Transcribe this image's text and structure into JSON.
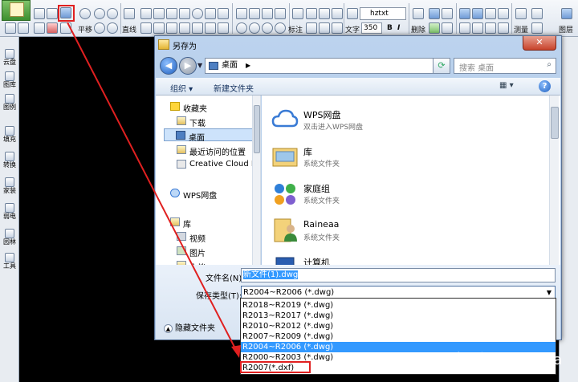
{
  "toolbar": {
    "pan_label": "平移",
    "line_label": "直线",
    "annotate_label": "标注",
    "text_label": "文字",
    "delete_label": "删除",
    "measure_label": "测量",
    "layer_label": "图层",
    "font_value": "hztxt",
    "size_value": "350",
    "bold_label": "B",
    "italic_label": "I"
  },
  "sidebar": {
    "items": [
      {
        "label": "云盘"
      },
      {
        "label": "图库"
      },
      {
        "label": "图例"
      },
      {
        "label": "填充"
      },
      {
        "label": "转换"
      },
      {
        "label": "家装"
      },
      {
        "label": "弱电"
      },
      {
        "label": "园林"
      },
      {
        "label": "工具"
      }
    ]
  },
  "dialog": {
    "title": "另存为",
    "close_label": "✕",
    "address": "桌面",
    "search_placeholder": "搜索 桌面",
    "organize_label": "组织 ▾",
    "new_folder_label": "新建文件夹",
    "nav": {
      "favorites": "收藏夹",
      "downloads": "下载",
      "desktop": "桌面",
      "recent": "最近访问的位置",
      "creative_cloud": "Creative Cloud F",
      "wps": "WPS网盘",
      "libraries": "库",
      "videos": "视频",
      "pictures": "图片",
      "documents": "文档"
    },
    "content": [
      {
        "name": "WPS网盘",
        "desc": "双击进入WPS网盘"
      },
      {
        "name": "库",
        "desc": "系统文件夹"
      },
      {
        "name": "家庭组",
        "desc": "系统文件夹"
      },
      {
        "name": "Raineaa",
        "desc": "系统文件夹"
      },
      {
        "name": "计算机",
        "desc": ""
      }
    ],
    "filename_label": "文件名(N):",
    "filename_value": "新文件(1).dwg",
    "filetype_label": "保存类型(T):",
    "filetype_value": "R2004~R2006 (*.dwg)",
    "hide_folders_label": "隐藏文件夹",
    "filetype_options": [
      "R2018~R2019 (*.dwg)",
      "R2013~R2017 (*.dwg)",
      "R2010~R2012 (*.dwg)",
      "R2007~R2009 (*.dwg)",
      "R2004~R2006 (*.dwg)",
      "R2000~R2003 (*.dwg)",
      "R2007(*.dxf)"
    ],
    "selected_option_index": 4
  },
  "watermark": "知乎 @Raineaa",
  "colors": {
    "highlight_red": "#e02020",
    "selection_blue": "#3399ff",
    "dialog_chrome": "#bcd3ee"
  }
}
